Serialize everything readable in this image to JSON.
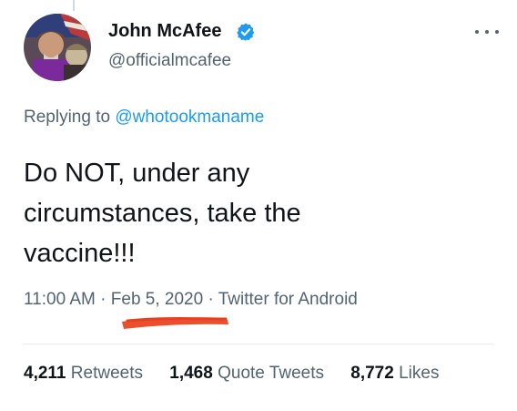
{
  "author": {
    "display_name": "John McAfee",
    "handle": "@officialmcafee",
    "verified": true
  },
  "reply": {
    "prefix": "Replying to",
    "mention": "@whotookmaname"
  },
  "tweet": {
    "text": "Do NOT, under any circumstances, take the vaccine!!!"
  },
  "meta": {
    "time": "11:00 AM",
    "separator": "·",
    "date": "Feb 5, 2020",
    "source": "Twitter for Android"
  },
  "stats": {
    "retweets_count": "4,211",
    "retweets_label": "Retweets",
    "quote_count": "1,468",
    "quote_label": "Quote Tweets",
    "likes_count": "8,772",
    "likes_label": "Likes"
  },
  "colors": {
    "link": "#1d9bf0",
    "secondary_text": "#536471",
    "primary_text": "#0f1419",
    "redaction": "#e8401c"
  },
  "icons": {
    "verified": "verified-badge-icon",
    "more": "more-options-icon"
  }
}
